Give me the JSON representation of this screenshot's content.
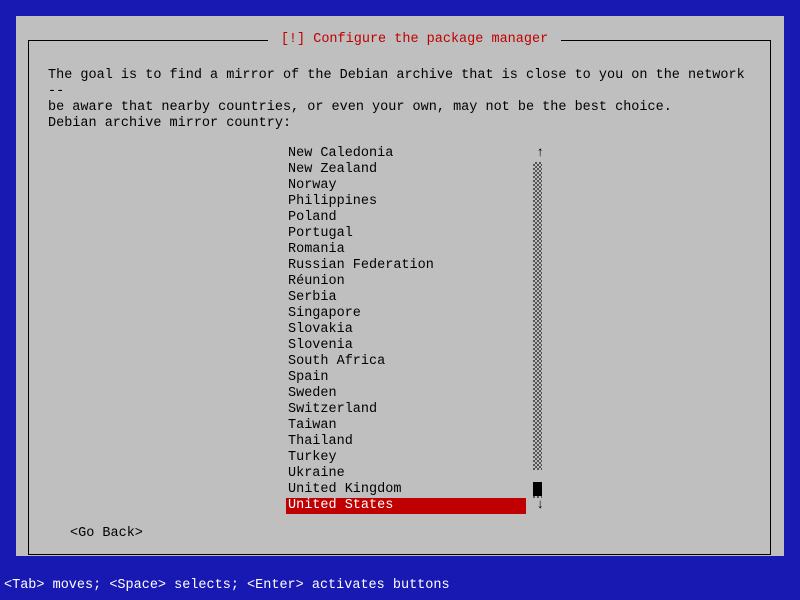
{
  "colors": {
    "bg_outer": "#1818b2",
    "bg_panel": "#bfbfbf",
    "accent": "#c00000",
    "text": "#000000",
    "hint": "#ffffff"
  },
  "frame": {
    "title": "[!] Configure the package manager"
  },
  "intro": "The goal is to find a mirror of the Debian archive that is close to you on the network --\nbe aware that nearby countries, or even your own, may not be the best choice.",
  "prompt": "Debian archive mirror country:",
  "list": {
    "items": [
      "New Caledonia",
      "New Zealand",
      "Norway",
      "Philippines",
      "Poland",
      "Portugal",
      "Romania",
      "Russian Federation",
      "Réunion",
      "Serbia",
      "Singapore",
      "Slovakia",
      "Slovenia",
      "South Africa",
      "Spain",
      "Sweden",
      "Switzerland",
      "Taiwan",
      "Thailand",
      "Turkey",
      "Ukraine",
      "United Kingdom",
      "United States"
    ],
    "selected_index": 22,
    "scroll_up_arrow": "↑",
    "scroll_down_arrow": "↓"
  },
  "go_back": "<Go Back>",
  "hint": "<Tab> moves; <Space> selects; <Enter> activates buttons"
}
